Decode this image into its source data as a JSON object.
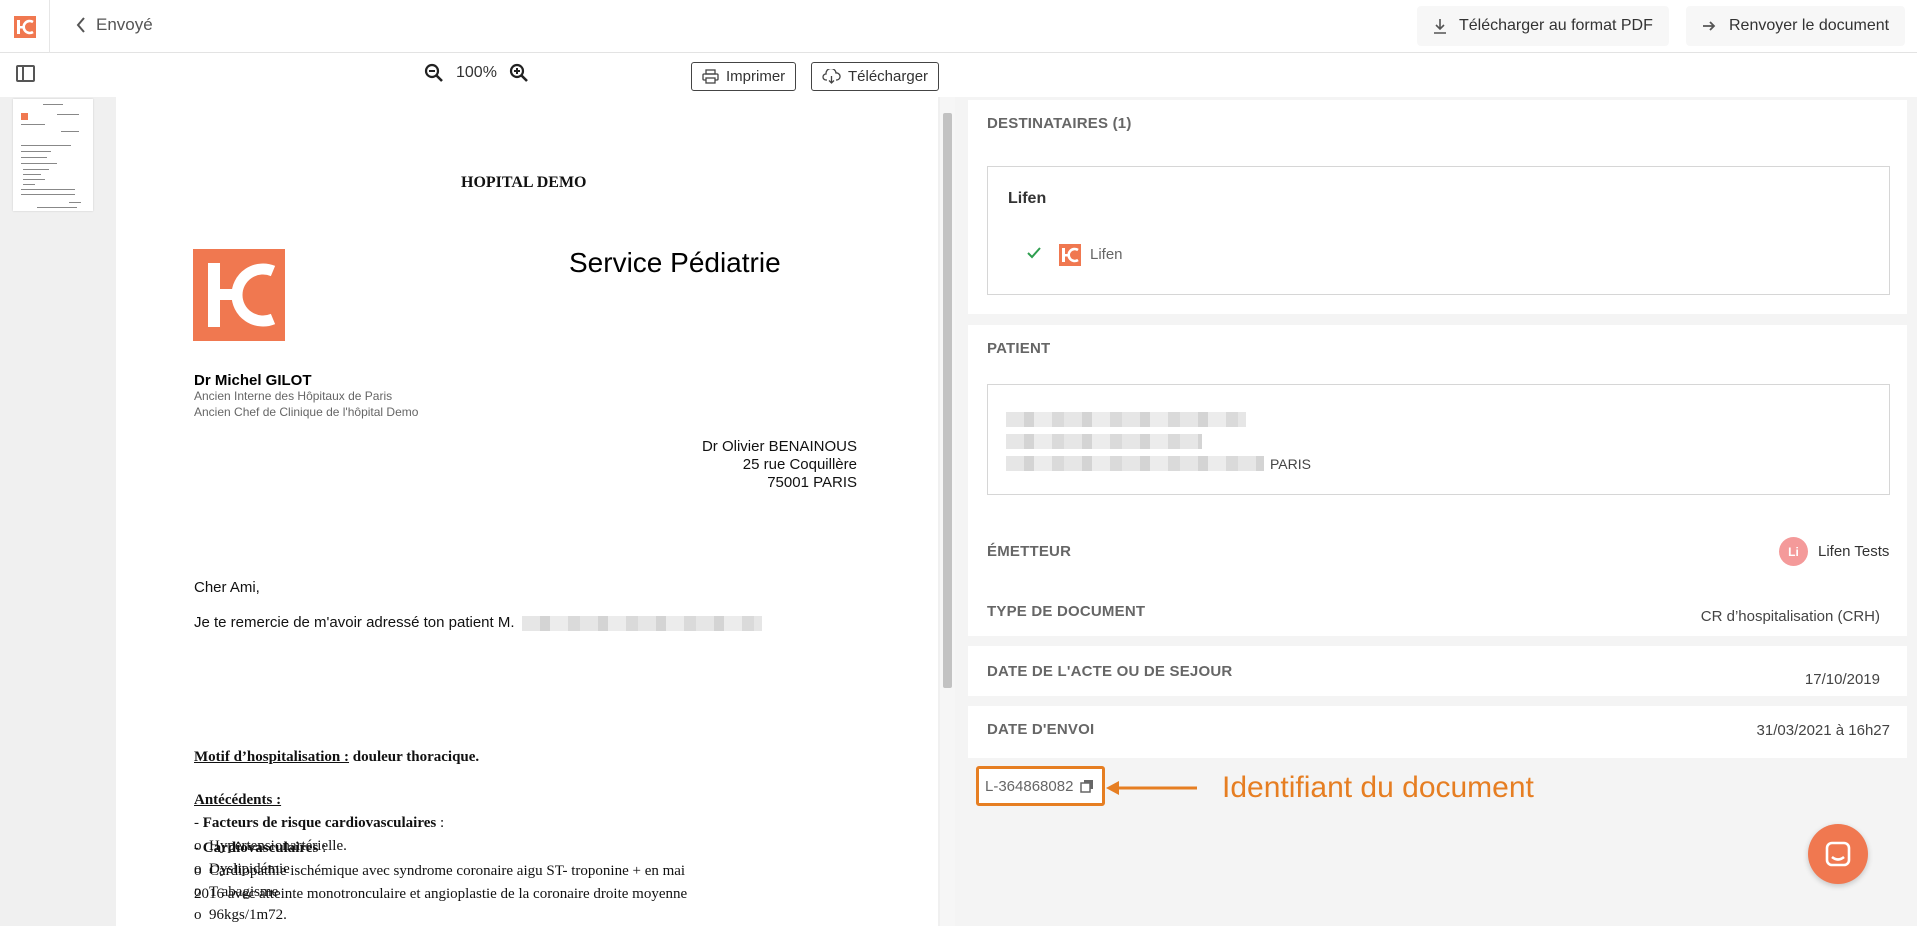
{
  "header": {
    "back_label": "Envoyé",
    "download_pdf_label": "Télécharger au format PDF",
    "resend_label": "Renvoyer le document"
  },
  "toolbar": {
    "zoom_level": "100%",
    "print_label": "Imprimer",
    "download_label": "Télécharger"
  },
  "document": {
    "hospital": "HOPITAL DEMO",
    "service": "Service Pédiatrie",
    "doctor_name": "Dr Michel GILOT",
    "doctor_title_1": "Ancien Interne des Hôpitaux de Paris",
    "doctor_title_2": "Ancien Chef de Clinique de l'hôpital Demo",
    "recipient_name": "Dr Olivier BENAINOUS",
    "recipient_street": "25 rue Coquillère",
    "recipient_city": "75001 PARIS",
    "greeting": "Cher Ami,",
    "thanks": "Je te remercie de m'avoir adressé ton patient M.",
    "motif_label": "Motif d’hospitalisation :",
    "motif_value": "douleur thoracique.",
    "antecedents_label": "Antécédents :",
    "risk_prefix": "- ",
    "risk_label": "Facteurs de risque cardiovasculaires",
    "risk_suffix": " :",
    "bullet": "o",
    "risk_items": [
      "Hypertensionartérielle.",
      "Dyslipidémie",
      "T abagisme",
      "96kgs/1m72."
    ],
    "cardio_prefix": "- ",
    "cardio_label": "Cardiovasculaires",
    "cardio_suffix": " :",
    "cardio_line_1": "Cardiopathie ischémique avec syndrome coronaire aigu ST- troponine + en mai",
    "cardio_line_2": "2016 avec atteinte monotronculaire et angioplastie de la coronaire droite moyenne"
  },
  "details": {
    "recipients_title": "DESTINATAIRES (1)",
    "recipient_group": "Lifen",
    "recipient_entry": "Lifen",
    "patient_title": "PATIENT",
    "patient_city": "PARIS",
    "sender_title": "ÉMETTEUR",
    "sender_initials": "Li",
    "sender_name": "Lifen Tests",
    "doctype_title": "TYPE DE DOCUMENT",
    "doctype_value": "CR d’hospitalisation (CRH)",
    "act_date_title": "DATE DE L'ACTE OU DE SEJOUR",
    "act_date_value": "17/10/2019",
    "sent_date_title": "DATE D'ENVOI",
    "sent_date_value": "31/03/2021 à 16h27",
    "document_id": "L-364868082",
    "annotation": "Identifiant du document"
  },
  "colors": {
    "brand_orange": "#f07850",
    "highlight_orange": "#e67e22",
    "check_green": "#2e9e4f",
    "sender_avatar": "#f49a9a"
  }
}
